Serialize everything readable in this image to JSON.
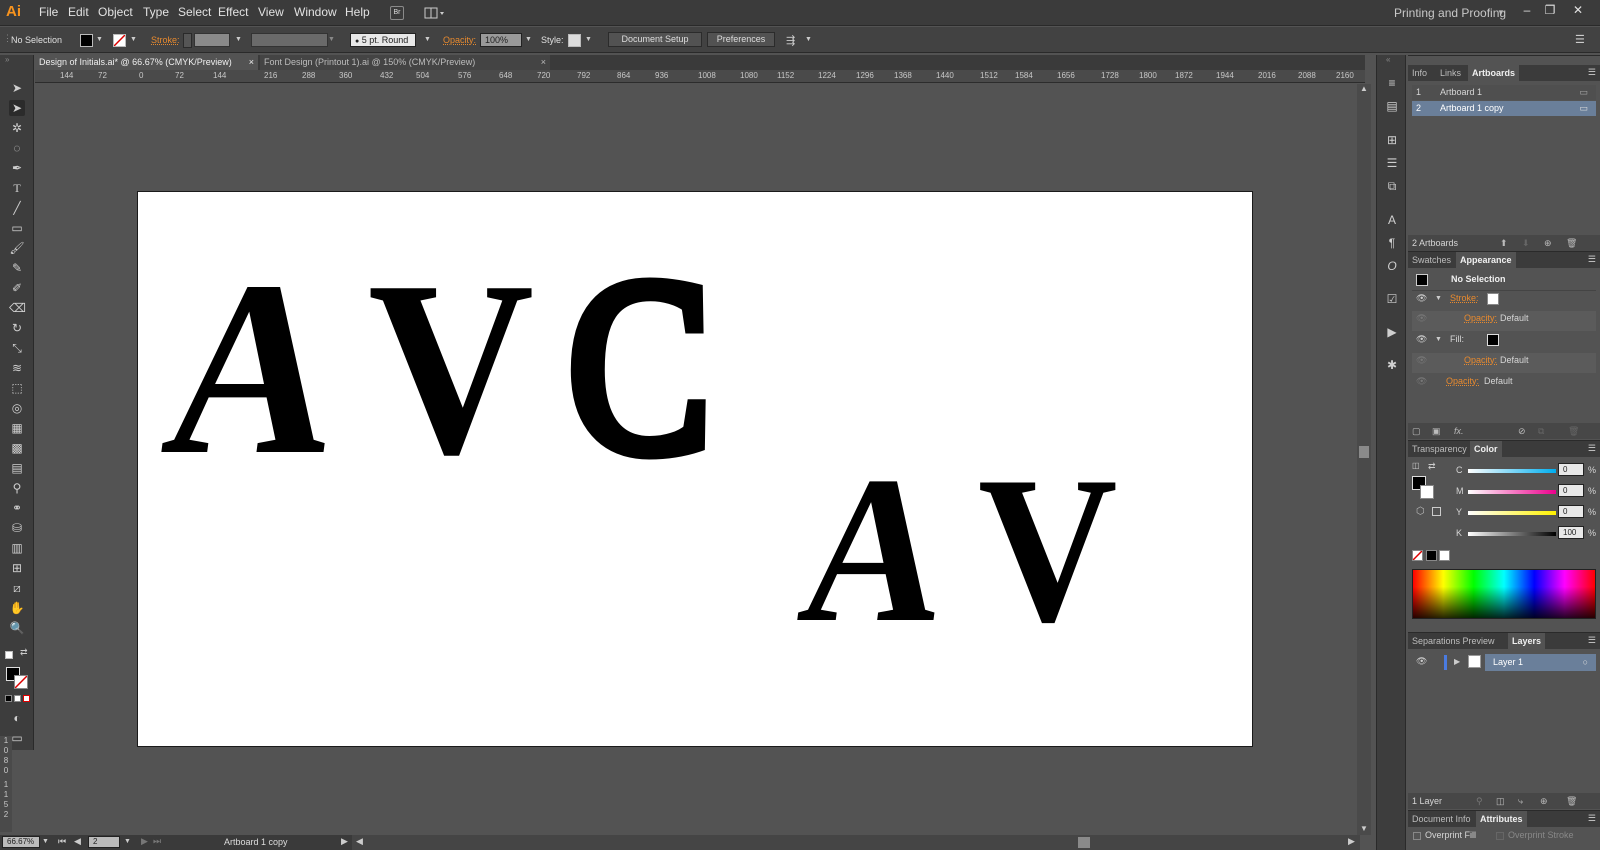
{
  "app": {
    "logo": "Ai"
  },
  "menu": [
    "File",
    "Edit",
    "Object",
    "Type",
    "Select",
    "Effect",
    "View",
    "Window",
    "Help"
  ],
  "bridge_label": "Br",
  "workspace": "Printing and Proofing",
  "window_controls": [
    "–",
    "❐",
    "✕"
  ],
  "control": {
    "selection": "No Selection",
    "stroke_label": "Stroke:",
    "brush": "5 pt. Round",
    "opacity_label": "Opacity:",
    "opacity_value": "100%",
    "style_label": "Style:",
    "document_setup": "Document Setup",
    "preferences": "Preferences"
  },
  "tabs": [
    {
      "label": "Design of Initials.ai* @ 66.67% (CMYK/Preview)",
      "close": "×"
    },
    {
      "label": "Font Design (Printout 1).ai @ 150% (CMYK/Preview)",
      "close": "×"
    }
  ],
  "ruler_top": [
    "144",
    "72",
    "0",
    "72",
    "144",
    "216",
    "288",
    "360",
    "432",
    "504",
    "576",
    "648",
    "720",
    "792",
    "864",
    "936",
    "1008",
    "1080",
    "1152",
    "1224",
    "1296",
    "1368",
    "1440",
    "1512",
    "1584",
    "1656",
    "1728",
    "1800",
    "1872",
    "1944",
    "2016",
    "2088",
    "2160"
  ],
  "ruler_left": [
    "1",
    "0",
    "8",
    "0",
    "1",
    "1",
    "5",
    "2"
  ],
  "artboard_text": {
    "line1": [
      "A",
      "V",
      "C"
    ],
    "line2": [
      "A",
      "V"
    ]
  },
  "status": {
    "zoom": "66.67%",
    "artboard_number": "2",
    "artboard_name": "Artboard 1 copy"
  },
  "artboards_panel": {
    "tabs": [
      "Info",
      "Links",
      "Artboards"
    ],
    "items": [
      {
        "num": "1",
        "name": "Artboard 1"
      },
      {
        "num": "2",
        "name": "Artboard 1 copy"
      }
    ],
    "count": "2 Artboards"
  },
  "appearance_panel": {
    "tabs": [
      "Swatches",
      "Appearance"
    ],
    "title": "No Selection",
    "stroke_label": "Stroke:",
    "opacity_label": "Opacity:",
    "default": "Default",
    "fill_label": "Fill:",
    "fx": "fx."
  },
  "color_panel": {
    "tabs": [
      "Transparency",
      "Color"
    ],
    "channels": [
      {
        "name": "C",
        "value": "0"
      },
      {
        "name": "M",
        "value": "0"
      },
      {
        "name": "Y",
        "value": "0"
      },
      {
        "name": "K",
        "value": "100"
      }
    ],
    "percent": "%"
  },
  "layers_panel": {
    "tabs": [
      "Separations Preview",
      "Layers"
    ],
    "layer": "Layer 1",
    "count": "1 Layer"
  },
  "attributes_panel": {
    "tabs": [
      "Document Info",
      "Attributes"
    ],
    "overprint_fill": "Overprint Fill",
    "overprint_stroke": "Overprint Stroke"
  }
}
